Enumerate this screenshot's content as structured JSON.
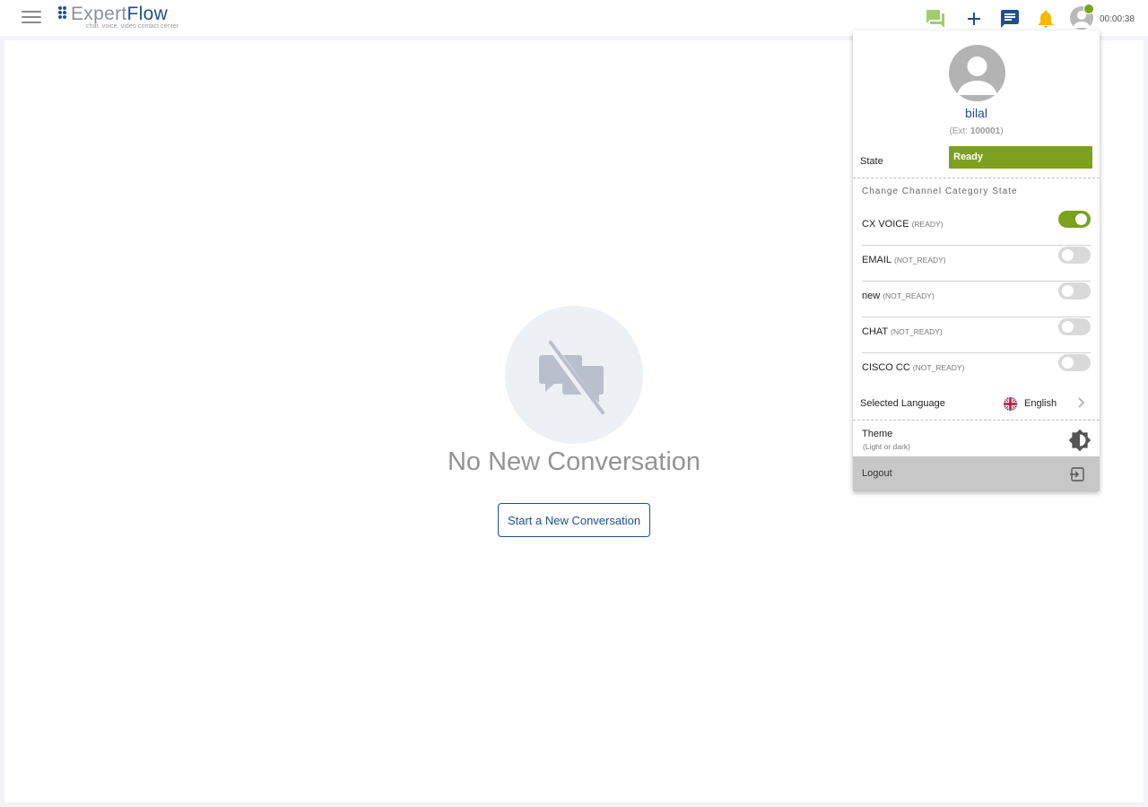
{
  "header": {
    "logo": {
      "word_part1": "Expert",
      "word_part2": "Flow",
      "tagline": "chat. voice. video contact center"
    },
    "timer": "00:00:38",
    "icons": [
      "menu-icon",
      "chat-bubbles-icon",
      "plus-icon",
      "message-icon",
      "bell-icon",
      "user-avatar-icon"
    ],
    "colors": {
      "brand": "#1d4f91",
      "ready": "#7ba11e",
      "bell": "#f5b800",
      "chats": "#9fce6f"
    }
  },
  "main": {
    "empty_title": "No New Conversation",
    "start_button": "Start a New Conversation",
    "empty_icon": "no-chat-icon"
  },
  "profile": {
    "name": "bilal",
    "ext_prefix": "(Ext: ",
    "ext": "100001",
    "ext_suffix": ")",
    "state_label": "State",
    "state_value": "Ready",
    "section_title": "Change Channel Category State",
    "channels": [
      {
        "name": "CX VOICE",
        "status": "(READY)",
        "on": true
      },
      {
        "name": "EMAIL",
        "status": "(NOT_READY)",
        "on": false
      },
      {
        "name": "new",
        "status": "(NOT_READY)",
        "on": false
      },
      {
        "name": "CHAT",
        "status": "(NOT_READY)",
        "on": false
      },
      {
        "name": "CISCO CC",
        "status": "(NOT_READY)",
        "on": false
      }
    ],
    "language_label": "Selected Language",
    "language_value": "English",
    "theme_label": "Theme",
    "theme_sub": "(Light or dark)",
    "logout_label": "Logout"
  }
}
